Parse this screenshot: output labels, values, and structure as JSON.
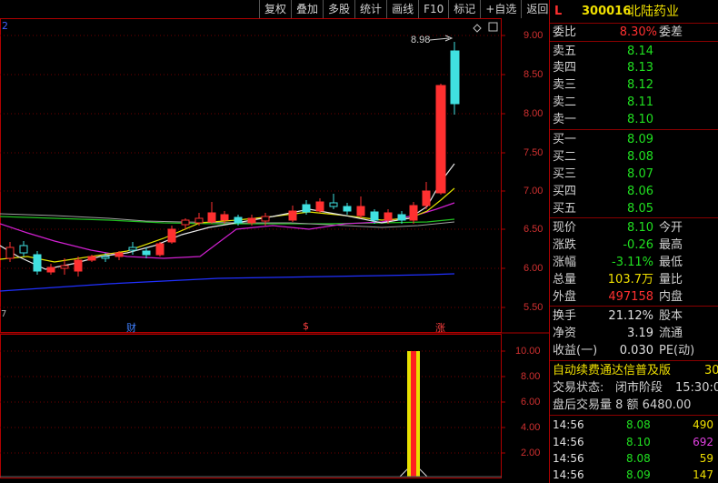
{
  "toolbar": {
    "buttons": [
      "复权",
      "叠加",
      "多股",
      "统计",
      "画线",
      "F10",
      "标记",
      "+自选",
      "返回"
    ]
  },
  "chart": {
    "left_label": "2",
    "bottom_left_label": "7",
    "price_ticks": [
      "9.00",
      "8.50",
      "8.00",
      "7.50",
      "7.00",
      "6.50",
      "6.00",
      "5.50"
    ],
    "high_marker": "8.98",
    "event_markers": [
      "财",
      "$",
      "涨"
    ],
    "volume_ticks": [
      "10.00",
      "8.00",
      "6.00",
      "4.00",
      "2.00"
    ]
  },
  "colors": {
    "up": "#ff3030",
    "down": "#40e0e0",
    "frame": "#b00000"
  },
  "quote": {
    "header_letter": "L",
    "code": "300016",
    "name": "北陆药业",
    "weibi_label": "委比",
    "weibi_value": "8.30%",
    "weicha_label": "委差",
    "sells": [
      {
        "label": "卖五",
        "price": "8.14"
      },
      {
        "label": "卖四",
        "price": "8.13"
      },
      {
        "label": "卖三",
        "price": "8.12"
      },
      {
        "label": "卖二",
        "price": "8.11"
      },
      {
        "label": "卖一",
        "price": "8.10"
      }
    ],
    "buys": [
      {
        "label": "买一",
        "price": "8.09"
      },
      {
        "label": "买二",
        "price": "8.08"
      },
      {
        "label": "买三",
        "price": "8.07"
      },
      {
        "label": "买四",
        "price": "8.06"
      },
      {
        "label": "买五",
        "price": "8.05"
      }
    ],
    "stats": [
      {
        "label": "现价",
        "value": "8.10",
        "label2": "今开"
      },
      {
        "label": "涨跌",
        "value": "-0.26",
        "label2": "最高"
      },
      {
        "label": "涨幅",
        "value": "-3.11%",
        "label2": "最低"
      },
      {
        "label": "总量",
        "value": "103.7万",
        "label2": "量比"
      },
      {
        "label": "外盘",
        "value": "497158",
        "label2": "内盘"
      }
    ],
    "extra": [
      {
        "label": "换手",
        "value": "21.12%",
        "label2": "股本"
      },
      {
        "label": "净资",
        "value": "3.19",
        "label2": "流通"
      },
      {
        "label": "收益(一)",
        "value": "0.030",
        "label2": "PE(动)"
      }
    ],
    "marquee": "自动续费通达信普及版",
    "marquee_tail": "30",
    "status_label": "交易状态:",
    "status_value": "闭市阶段",
    "status_time": "15:30:0",
    "after_hours": "盘后交易量 8 额 6480.00",
    "ticks": [
      {
        "time": "14:56",
        "price": "8.08",
        "vol": "490",
        "vcolor": "yellow"
      },
      {
        "time": "14:56",
        "price": "8.10",
        "vol": "692",
        "vcolor": "magenta"
      },
      {
        "time": "14:56",
        "price": "8.08",
        "vol": "59",
        "vcolor": "yellow"
      },
      {
        "time": "14:56",
        "price": "8.09",
        "vol": "147",
        "vcolor": "yellow"
      }
    ]
  }
}
